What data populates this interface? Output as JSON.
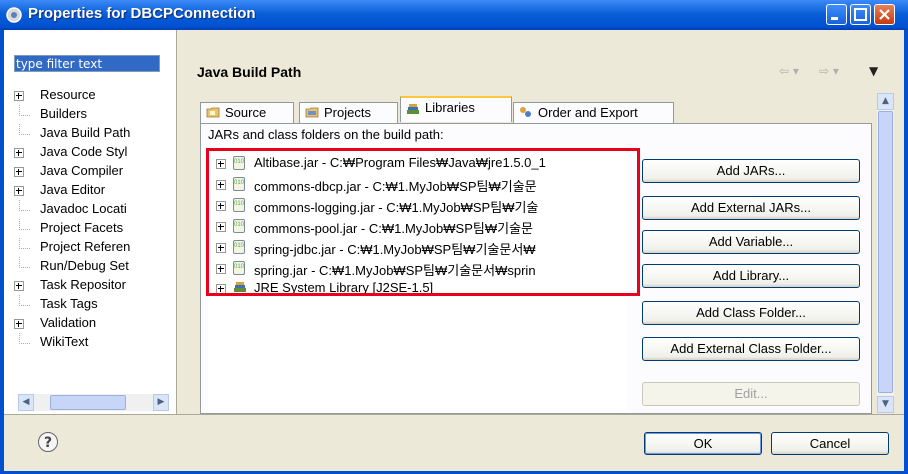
{
  "window": {
    "title": "Properties for DBCPConnection"
  },
  "filter": {
    "value": "type filter text"
  },
  "tree": {
    "items": [
      {
        "label": "Resource",
        "expandable": true
      },
      {
        "label": "Builders",
        "expandable": false
      },
      {
        "label": "Java Build Path",
        "expandable": false
      },
      {
        "label": "Java Code Styl",
        "expandable": true
      },
      {
        "label": "Java Compiler",
        "expandable": true
      },
      {
        "label": "Java Editor",
        "expandable": true
      },
      {
        "label": "Javadoc Locati",
        "expandable": false
      },
      {
        "label": "Project Facets",
        "expandable": false
      },
      {
        "label": "Project Referen",
        "expandable": false
      },
      {
        "label": "Run/Debug Set",
        "expandable": false
      },
      {
        "label": "Task Repositor",
        "expandable": true
      },
      {
        "label": "Task Tags",
        "expandable": false
      },
      {
        "label": "Validation",
        "expandable": true
      },
      {
        "label": "WikiText",
        "expandable": false
      }
    ]
  },
  "page": {
    "title": "Java Build Path",
    "nav_back": "⇦ ▾",
    "nav_fwd": "⇨ ▾",
    "nav_menu": "▼"
  },
  "tabs": [
    {
      "label": "Source"
    },
    {
      "label": "Projects"
    },
    {
      "label": "Libraries"
    },
    {
      "label": "Order and Export"
    }
  ],
  "libraries": {
    "hint": "JARs and class folders on the build path:",
    "jars": [
      {
        "label": "Altibase.jar - C:₩Program Files₩Java₩jre1.5.0_1"
      },
      {
        "label": "commons-dbcp.jar - C:₩1.MyJob₩SP팀₩기술문"
      },
      {
        "label": "commons-logging.jar - C:₩1.MyJob₩SP팀₩기술"
      },
      {
        "label": "commons-pool.jar - C:₩1.MyJob₩SP팀₩기술문"
      },
      {
        "label": "spring-jdbc.jar - C:₩1.MyJob₩SP팀₩기술문서₩"
      },
      {
        "label": "spring.jar - C:₩1.MyJob₩SP팀₩기술문서₩sprin"
      },
      {
        "label": "JRE System Library [J2SE-1.5]"
      }
    ],
    "buttons": {
      "add_jars": "Add JARs...",
      "add_external_jars": "Add External JARs...",
      "add_variable": "Add Variable...",
      "add_library": "Add Library...",
      "add_class_folder": "Add Class Folder...",
      "add_external_class_folder": "Add External Class Folder...",
      "edit": "Edit..."
    }
  },
  "footer": {
    "help": "?",
    "ok": "OK",
    "cancel": "Cancel"
  }
}
